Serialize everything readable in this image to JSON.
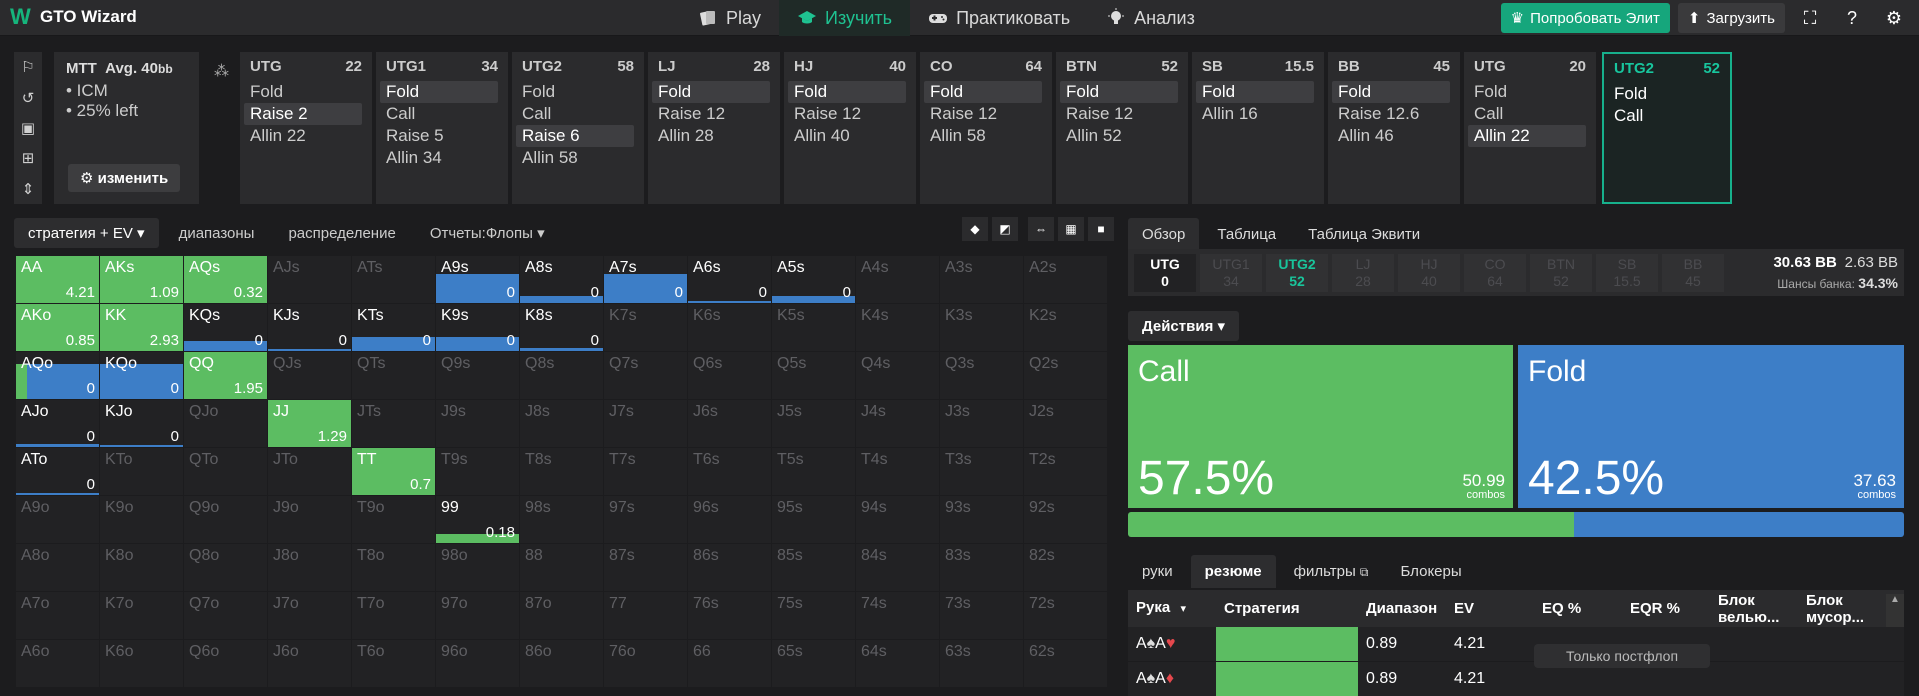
{
  "app": {
    "name": "GTO Wizard"
  },
  "nav": {
    "items": [
      {
        "label": "Play",
        "icon": "cards-icon"
      },
      {
        "label": "Изучить",
        "icon": "grad-cap-icon",
        "active": true
      },
      {
        "label": "Практиковать",
        "icon": "gamepad-icon"
      },
      {
        "label": "Анализ",
        "icon": "bulb-icon"
      }
    ]
  },
  "topright": {
    "elite": "Попробовать Элит",
    "upload": "Загрузить"
  },
  "mtt": {
    "title": "MTT",
    "avg": "Avg. 40",
    "avg_unit": "bb",
    "lines": [
      "• ICM",
      "• 25% left"
    ],
    "edit": "изменить"
  },
  "seats": [
    {
      "pos": "UTG",
      "stack": "22",
      "actions": [
        "Fold",
        "Raise 2",
        "Allin 22"
      ],
      "sel": 1
    },
    {
      "pos": "UTG1",
      "stack": "34",
      "actions": [
        "Fold",
        "Call",
        "Raise 5",
        "Allin 34"
      ],
      "sel": 0
    },
    {
      "pos": "UTG2",
      "stack": "58",
      "actions": [
        "Fold",
        "Call",
        "Raise 6",
        "Allin 58"
      ],
      "sel": 2
    },
    {
      "pos": "LJ",
      "stack": "28",
      "actions": [
        "Fold",
        "Raise 12",
        "Allin 28"
      ],
      "sel": 0
    },
    {
      "pos": "HJ",
      "stack": "40",
      "actions": [
        "Fold",
        "Raise 12",
        "Allin 40"
      ],
      "sel": 0
    },
    {
      "pos": "CO",
      "stack": "64",
      "actions": [
        "Fold",
        "Raise 12",
        "Allin 58"
      ],
      "sel": 0
    },
    {
      "pos": "BTN",
      "stack": "52",
      "actions": [
        "Fold",
        "Raise 12",
        "Allin 52"
      ],
      "sel": 0
    },
    {
      "pos": "SB",
      "stack": "15.5",
      "actions": [
        "Fold",
        "Allin 16"
      ],
      "sel": 0
    },
    {
      "pos": "BB",
      "stack": "45",
      "actions": [
        "Fold",
        "Raise 12.6",
        "Allin 46"
      ],
      "sel": 0
    },
    {
      "pos": "UTG",
      "stack": "20",
      "actions": [
        "Fold",
        "Call",
        "Allin 22"
      ],
      "sel": 2
    },
    {
      "pos": "UTG2",
      "stack": "52",
      "actions": [
        "Fold",
        "Call"
      ],
      "sel": -1,
      "current": true
    }
  ],
  "left_tabs": [
    "стратегия + EV",
    "диапазоны",
    "распределение",
    "Отчеты:Флопы"
  ],
  "grid": {
    "colors": {
      "call": "#5cbd62",
      "fold": "#3d7ec7",
      "empty": "#222224"
    },
    "cells": [
      {
        "h": "AA",
        "ev": "4.21",
        "on": true,
        "call": 1,
        "fold": 0
      },
      {
        "h": "AKs",
        "ev": "1.09",
        "on": true,
        "call": 1,
        "fold": 0
      },
      {
        "h": "AQs",
        "ev": "0.32",
        "on": true,
        "call": 1,
        "fold": 0
      },
      {
        "h": "AJs"
      },
      {
        "h": "ATs"
      },
      {
        "h": "A9s",
        "ev": "0",
        "on": true,
        "call": 0,
        "fold": 0.62
      },
      {
        "h": "A8s",
        "ev": "0",
        "on": true,
        "call": 0,
        "fold": 0.15
      },
      {
        "h": "A7s",
        "ev": "0",
        "on": true,
        "call": 0,
        "fold": 0.62
      },
      {
        "h": "A6s",
        "ev": "0",
        "on": true,
        "call": 0,
        "fold": 0
      },
      {
        "h": "A5s",
        "ev": "0",
        "on": true,
        "call": 0,
        "fold": 0.15
      },
      {
        "h": "A4s"
      },
      {
        "h": "A3s"
      },
      {
        "h": "A2s"
      },
      {
        "h": "AKo",
        "ev": "0.85",
        "on": true,
        "call": 1,
        "fold": 0
      },
      {
        "h": "KK",
        "ev": "2.93",
        "on": true,
        "call": 1,
        "fold": 0
      },
      {
        "h": "KQs",
        "ev": "0",
        "on": true,
        "call": 0,
        "fold": 0.22
      },
      {
        "h": "KJs",
        "ev": "0",
        "on": true,
        "call": 0,
        "fold": 0
      },
      {
        "h": "KTs",
        "ev": "0",
        "on": true,
        "call": 0,
        "fold": 0.3
      },
      {
        "h": "K9s",
        "ev": "0",
        "on": true,
        "call": 0,
        "fold": 0.3
      },
      {
        "h": "K8s",
        "ev": "0",
        "on": true,
        "call": 0,
        "fold": 0.06
      },
      {
        "h": "K7s"
      },
      {
        "h": "K6s"
      },
      {
        "h": "K5s"
      },
      {
        "h": "K4s"
      },
      {
        "h": "K3s"
      },
      {
        "h": "K2s"
      },
      {
        "h": "AQo",
        "ev": "0",
        "on": true,
        "call": 0.13,
        "fold": 0.75
      },
      {
        "h": "KQo",
        "ev": "0",
        "on": true,
        "call": 0,
        "fold": 0.75
      },
      {
        "h": "QQ",
        "ev": "1.95",
        "on": true,
        "call": 1,
        "fold": 0
      },
      {
        "h": "QJs"
      },
      {
        "h": "QTs"
      },
      {
        "h": "Q9s"
      },
      {
        "h": "Q8s"
      },
      {
        "h": "Q7s"
      },
      {
        "h": "Q6s"
      },
      {
        "h": "Q5s"
      },
      {
        "h": "Q4s"
      },
      {
        "h": "Q3s"
      },
      {
        "h": "Q2s"
      },
      {
        "h": "AJo",
        "ev": "0",
        "on": true,
        "call": 0,
        "fold": 0.06
      },
      {
        "h": "KJo",
        "ev": "0",
        "on": true,
        "call": 0,
        "fold": 0.04
      },
      {
        "h": "QJo"
      },
      {
        "h": "JJ",
        "ev": "1.29",
        "on": true,
        "call": 1,
        "fold": 0
      },
      {
        "h": "JTs"
      },
      {
        "h": "J9s"
      },
      {
        "h": "J8s"
      },
      {
        "h": "J7s"
      },
      {
        "h": "J6s"
      },
      {
        "h": "J5s"
      },
      {
        "h": "J4s"
      },
      {
        "h": "J3s"
      },
      {
        "h": "J2s"
      },
      {
        "h": "ATo",
        "ev": "0",
        "on": true,
        "call": 0,
        "fold": 0.04
      },
      {
        "h": "KTo"
      },
      {
        "h": "QTo"
      },
      {
        "h": "JTo"
      },
      {
        "h": "TT",
        "ev": "0.7",
        "on": true,
        "call": 1,
        "fold": 0
      },
      {
        "h": "T9s"
      },
      {
        "h": "T8s"
      },
      {
        "h": "T7s"
      },
      {
        "h": "T6s"
      },
      {
        "h": "T5s"
      },
      {
        "h": "T4s"
      },
      {
        "h": "T3s"
      },
      {
        "h": "T2s"
      },
      {
        "h": "A9o"
      },
      {
        "h": "K9o"
      },
      {
        "h": "Q9o"
      },
      {
        "h": "J9o"
      },
      {
        "h": "T9o"
      },
      {
        "h": "99",
        "ev": "0.18",
        "on": true,
        "call": 0.2,
        "fold": 0
      },
      {
        "h": "98s"
      },
      {
        "h": "97s"
      },
      {
        "h": "96s"
      },
      {
        "h": "95s"
      },
      {
        "h": "94s"
      },
      {
        "h": "93s"
      },
      {
        "h": "92s"
      },
      {
        "h": "A8o"
      },
      {
        "h": "K8o"
      },
      {
        "h": "Q8o"
      },
      {
        "h": "J8o"
      },
      {
        "h": "T8o"
      },
      {
        "h": "98o"
      },
      {
        "h": "88"
      },
      {
        "h": "87s"
      },
      {
        "h": "86s"
      },
      {
        "h": "85s"
      },
      {
        "h": "84s"
      },
      {
        "h": "83s"
      },
      {
        "h": "82s"
      },
      {
        "h": "A7o"
      },
      {
        "h": "K7o"
      },
      {
        "h": "Q7o"
      },
      {
        "h": "J7o"
      },
      {
        "h": "T7o"
      },
      {
        "h": "97o"
      },
      {
        "h": "87o"
      },
      {
        "h": "77"
      },
      {
        "h": "76s"
      },
      {
        "h": "75s"
      },
      {
        "h": "74s"
      },
      {
        "h": "73s"
      },
      {
        "h": "72s"
      },
      {
        "h": "A6o"
      },
      {
        "h": "K6o"
      },
      {
        "h": "Q6o"
      },
      {
        "h": "J6o"
      },
      {
        "h": "T6o"
      },
      {
        "h": "96o"
      },
      {
        "h": "86o"
      },
      {
        "h": "76o"
      },
      {
        "h": "66"
      },
      {
        "h": "65s"
      },
      {
        "h": "64s"
      },
      {
        "h": "63s"
      },
      {
        "h": "62s"
      }
    ]
  },
  "right_tabs": [
    "Обзор",
    "Таблица",
    "Таблица Эквити"
  ],
  "positions": [
    {
      "p": "UTG",
      "v": "0",
      "state": "me"
    },
    {
      "p": "UTG1",
      "v": "34"
    },
    {
      "p": "UTG2",
      "v": "52",
      "state": "hi"
    },
    {
      "p": "LJ",
      "v": "28"
    },
    {
      "p": "HJ",
      "v": "40"
    },
    {
      "p": "CO",
      "v": "64"
    },
    {
      "p": "BTN",
      "v": "52"
    },
    {
      "p": "SB",
      "v": "15.5"
    },
    {
      "p": "BB",
      "v": "45"
    }
  ],
  "pot": {
    "main": "30.63 BB",
    "side": "2.63 BB",
    "odds_label": "Шансы банка:",
    "odds": "34.3%"
  },
  "actions_dd": "Действия",
  "summary": [
    {
      "name": "Call",
      "pct": "57.5%",
      "combos": "50.99",
      "combos_label": "combos",
      "frac": 0.575,
      "color": "#5cbd62"
    },
    {
      "name": "Fold",
      "pct": "42.5%",
      "combos": "37.63",
      "combos_label": "combos",
      "frac": 0.425,
      "color": "#3d7ec7"
    }
  ],
  "bottom_tabs": [
    "руки",
    "резюме",
    "фильтры",
    "Блокеры"
  ],
  "table": {
    "headers": [
      "Рука",
      "Стратегия",
      "Диапазон",
      "EV",
      "EQ %",
      "EQR %",
      "Блок велью...",
      "Блок мусор..."
    ],
    "rows": [
      {
        "hand": "A♠A♥",
        "range": "0.89",
        "ev": "4.21"
      },
      {
        "hand": "A♠A♦",
        "range": "0.89",
        "ev": "4.21"
      }
    ]
  },
  "tooltip": "Только постфлоп"
}
